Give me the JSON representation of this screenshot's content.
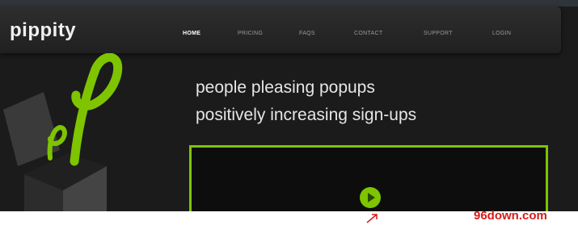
{
  "brand": {
    "name": "pippity",
    "accent": "#7ec400"
  },
  "nav": {
    "items": [
      {
        "label": "HOME",
        "active": true
      },
      {
        "label": "PRICING",
        "active": false
      },
      {
        "label": "FAQS",
        "active": false
      },
      {
        "label": "CONTACT",
        "active": false
      },
      {
        "label": "SUPPORT",
        "active": false
      },
      {
        "label": "LOGIN",
        "active": false
      }
    ]
  },
  "hero": {
    "headline_line1": "people pleasing popups",
    "headline_line2": "positively increasing sign-ups",
    "video": {
      "play_icon": "play-icon"
    }
  },
  "watermark": {
    "text": "96down.com",
    "color": "#d81a1a"
  }
}
